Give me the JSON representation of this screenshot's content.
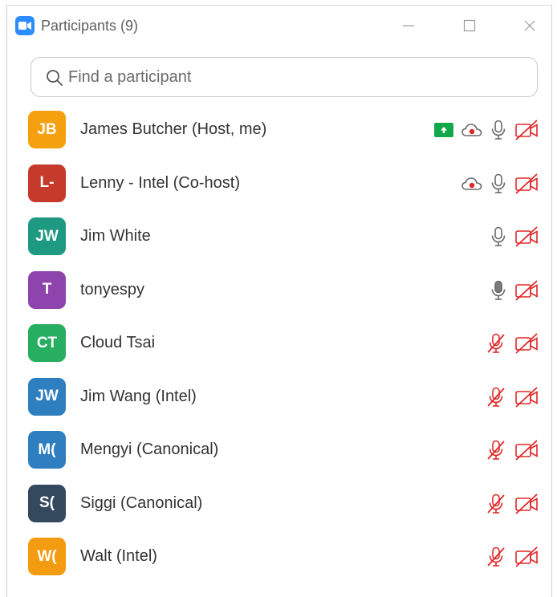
{
  "window": {
    "title": "Participants (9)"
  },
  "search": {
    "placeholder": "Find a participant"
  },
  "colors": {
    "accent": "#2d8cff",
    "muted_red": "#e02828",
    "share_green": "#12a84a"
  },
  "participants": [
    {
      "initials": "JB",
      "name": "James Butcher (Host, me)",
      "color": "#f5a00f",
      "sharing": true,
      "recording": true,
      "mic": "on",
      "video": "off"
    },
    {
      "initials": "L-",
      "name": "Lenny - Intel (Co-host)",
      "color": "#c53a2b",
      "sharing": false,
      "recording": true,
      "mic": "on",
      "video": "off"
    },
    {
      "initials": "JW",
      "name": "Jim White",
      "color": "#1f9a82",
      "sharing": false,
      "recording": false,
      "mic": "on",
      "video": "off"
    },
    {
      "initials": "T",
      "name": "tonyespy",
      "color": "#8e44ad",
      "sharing": false,
      "recording": false,
      "mic": "speaking",
      "video": "off"
    },
    {
      "initials": "CT",
      "name": "Cloud Tsai",
      "color": "#27ae60",
      "sharing": false,
      "recording": false,
      "mic": "muted",
      "video": "off"
    },
    {
      "initials": "JW",
      "name": "Jim Wang (Intel)",
      "color": "#2f7fc0",
      "sharing": false,
      "recording": false,
      "mic": "muted",
      "video": "off"
    },
    {
      "initials": "M(",
      "name": "Mengyi (Canonical)",
      "color": "#2f7fc0",
      "sharing": false,
      "recording": false,
      "mic": "muted",
      "video": "off"
    },
    {
      "initials": "S(",
      "name": "Siggi (Canonical)",
      "color": "#34495e",
      "sharing": false,
      "recording": false,
      "mic": "muted",
      "video": "off"
    },
    {
      "initials": "W(",
      "name": "Walt (Intel)",
      "color": "#f39c12",
      "sharing": false,
      "recording": false,
      "mic": "muted",
      "video": "off"
    }
  ]
}
